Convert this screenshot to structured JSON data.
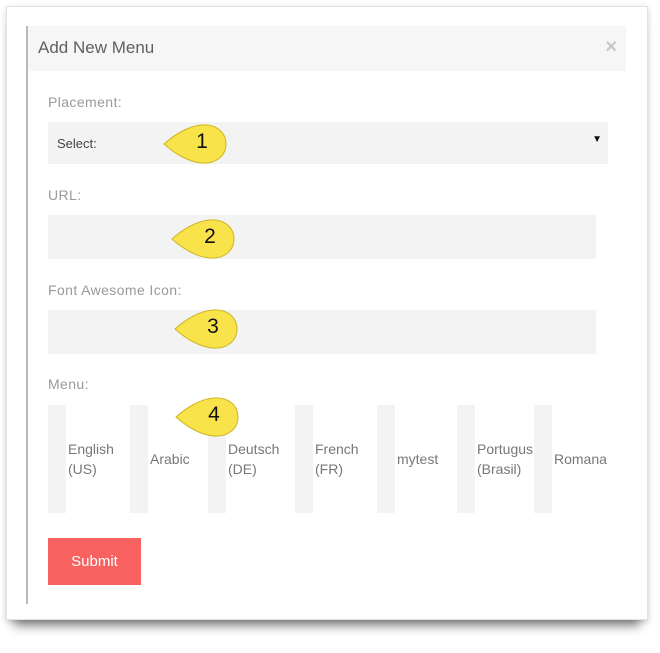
{
  "modal": {
    "title": "Add New Menu",
    "close_symbol": "×"
  },
  "form": {
    "placement": {
      "label": "Placement:",
      "selected": "Select:",
      "arrow": "▼"
    },
    "url": {
      "label": "URL:",
      "value": ""
    },
    "icon": {
      "label": "Font Awesome Icon:",
      "value": ""
    },
    "menu": {
      "label": "Menu:",
      "languages": [
        {
          "label": "English (US)"
        },
        {
          "label": "Arabic"
        },
        {
          "label": "Deutsch (DE)"
        },
        {
          "label": "French (FR)"
        },
        {
          "label": "mytest"
        },
        {
          "label": "Portugus (Brasil)"
        },
        {
          "label": "Romana"
        }
      ]
    },
    "submit_label": "Submit"
  },
  "callouts": [
    "1",
    "2",
    "3",
    "4"
  ],
  "colors": {
    "callout_fill": "#f9e34a",
    "submit_bg": "#f76260"
  }
}
